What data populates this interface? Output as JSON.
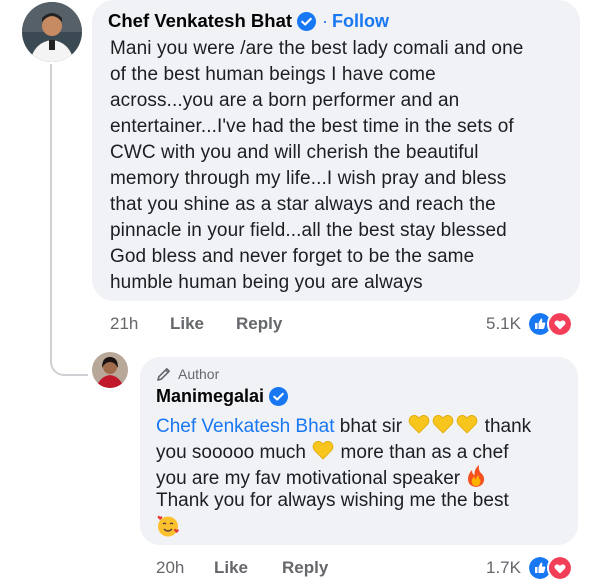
{
  "comment": {
    "author": "Chef Venkatesh Bhat",
    "follow_label": "Follow",
    "separator": "·",
    "lines": [
      "Mani you were /are the best lady comali and one",
      "of the best human beings I have come",
      "across...you are a born performer and an",
      "entertainer...I've had the  best time in the sets of",
      "CWC with you and will cherish the beautiful",
      "memory through my life...I wish pray and bless",
      "that you shine as a star always and reach the",
      "pinnacle in your field...all the best stay blessed",
      "God bless and never forget to be the same",
      "humble human being you are always"
    ],
    "time": "21h",
    "like_label": "Like",
    "reply_label": "Reply",
    "reaction_count": "5.1K",
    "reaction_icons": [
      "like-icon",
      "love-icon"
    ]
  },
  "reply": {
    "author_badge": "Author",
    "author": "Manimegalai",
    "mention": "Chef Venkatesh Bhat",
    "line1_text": " bhat sir ",
    "line1_end": " thank",
    "line2_text": "you sooooo much ",
    "line2_end": " more than as a chef",
    "line3_text": "you are my fav motivational speaker ",
    "line4_text": "Thank you for always wishing me the best",
    "emojis": [
      "yellow-heart-icon",
      "fire-icon",
      "smiling-face-with-hearts-icon"
    ],
    "time": "20h",
    "like_label": "Like",
    "reply_label": "Reply",
    "reaction_count": "1.7K",
    "reaction_icons": [
      "like-icon",
      "love-icon"
    ]
  },
  "colors": {
    "bubble": "#f0f2f5",
    "link": "#1877f2",
    "meta": "#65676b",
    "love": "#f33e58"
  }
}
